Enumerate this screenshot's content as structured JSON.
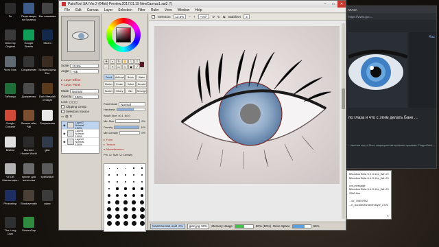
{
  "app": {
    "title": "PaintTool SAI Ver.2 (64bit) Preview.2017.01.19   NewCanvas1.sai2 (*)",
    "menu": [
      "File",
      "Edit",
      "Canvas",
      "Layer",
      "Selection",
      "Filter",
      "Ruler",
      "View",
      "Window",
      "Help"
    ]
  },
  "navigator": {
    "scale_label": "Scale",
    "scale_value": "12.5%",
    "angle_label": "Angle",
    "angle_value": "+0$"
  },
  "layer_panel": {
    "layer_effect": "Layer Effect",
    "layer_panel_label": "Layer Panel",
    "mode_label": "Mode",
    "mode_value": "Normal",
    "opacity_label": "Opacity",
    "opacity_value": "100%",
    "lock_label": "Lock",
    "clipping_group": "Clipping Group",
    "selection_source": "Selection Source",
    "layers": [
      {
        "name": "Layer2",
        "mode": "Normal",
        "opacity": "100%"
      },
      {
        "name": "Layer1",
        "mode": "Normal",
        "opacity": "100%"
      },
      {
        "name": "Layer3",
        "mode": "Normal",
        "opacity": "100%"
      }
    ]
  },
  "tool_panel": {
    "brushes": [
      "Pencil",
      "AirBrush",
      "Brush",
      "Water",
      "Marker",
      "Eraser",
      "Select",
      "Deselct",
      "Bucket",
      "Binary",
      "Blur",
      "Smudge"
    ],
    "paint_mode_label": "Paint Mode",
    "paint_mode_value": "Normal",
    "hardness_label": "Hardness",
    "brush_size_label": "Brush Size",
    "brush_size_mult": "x0.1",
    "brush_size_value": "80.0",
    "min_size_label": "Min Size",
    "min_size_value": "0%",
    "density_label": "Density",
    "density_value": "100",
    "min_density_label": "Min Density",
    "min_density_value": "0%",
    "form_label": "Form",
    "texture_label": "Texture",
    "misc_label": "Miscellaneous",
    "prs_label": "Prs",
    "size_label": "Size",
    "density_chk_label": "Density",
    "dot_sizes": [
      "0.6",
      "0.8",
      "1",
      "1.5",
      "2",
      "2.3",
      "2.6",
      "3",
      "3.5",
      "4",
      "5",
      "6",
      "7",
      "8",
      "9",
      "10",
      "12",
      "14",
      "16",
      "20",
      "25",
      "30",
      "35",
      "40",
      "50",
      "60",
      "70",
      "80",
      "100",
      "120",
      "160",
      "200",
      "250",
      "300",
      "350",
      "400",
      "450",
      "500",
      "600",
      "700",
      "800",
      "1000",
      "1200",
      "1600",
      "2000"
    ]
  },
  "canvas_toolbar": {
    "selection_label": "Selection",
    "zoom": "12.5%",
    "angle": "+0.0°",
    "stabilizer_label": "Stabilizer",
    "stabilizer_value": "3"
  },
  "statusbar": {
    "docs": [
      {
        "name": "NewCanvas1.sai2",
        "pct": "6%"
      },
      {
        "name": "glaz.jpg",
        "pct": "50%"
      }
    ],
    "memory_label": "Memory Usage",
    "memory_value": "50% (50%)",
    "memory_fill": 0.5,
    "drive_label": "Drive Space",
    "drive_value": "65%",
    "drive_fill": 0.65
  },
  "browser": {
    "tab": "ГЛАЗА",
    "address": "https://www.goo...",
    "headline": "по глаза и что с этим делать Банк ...",
    "caption": "...ажения могут быть защищены авторскими правами. Подробнее...",
    "side_link": "Kaz"
  },
  "popup": {
    "lines": [
      "Mleadow Beta 0-0-3-11a_Win.7z",
      "Mleadow Beta 0-0-3-11a_Win.7z",
      "...",
      "vcs-message",
      "Mleadow Beta 0-0-3-11a_Win.7z",
      "2560.fws",
      "...",
      "...ck_70657952",
      "...lr_Architectsmenth/style_27c0"
    ]
  },
  "desktop_icons": [
    {
      "label": "Fe",
      "color": "#2b2b2b"
    },
    {
      "label": "Dimmmy Original",
      "color": "#3a3a3a"
    },
    {
      "label": "Фото Mos",
      "color": "#606a72"
    },
    {
      "label": "Таблицы",
      "color": "#1f6e3a"
    },
    {
      "label": "Google Chrome",
      "color": "#d04a37"
    },
    {
      "label": "Вайтаг",
      "color": "#e0e0e0"
    },
    {
      "label": "ЧПОВ Магнитофон",
      "color": "#b4b4b4"
    },
    {
      "label": "Photoshop",
      "color": "#1e2e63"
    },
    {
      "label": "The Long Dark",
      "color": "#2e3033"
    },
    {
      "label": "Переговоры по бизнесу",
      "color": "#3d5a88"
    },
    {
      "label": "Google Sheets",
      "color": "#0f9d58"
    },
    {
      "label": "Сохранение",
      "color": "#343434"
    },
    {
      "label": "Документы",
      "color": "#4b4b4b"
    },
    {
      "label": "Season after Fall",
      "color": "#7a4e2e"
    },
    {
      "label": "Monster Hunter World",
      "color": "#2a2a2a"
    },
    {
      "label": "проект для агентства",
      "color": "#6b6b6b"
    },
    {
      "label": "Shadowmatic",
      "color": "#4a4035"
    },
    {
      "label": "ScreenCap",
      "color": "#2e8b3f"
    },
    {
      "label": "Без названия",
      "color": "#444"
    },
    {
      "label": "Steam",
      "color": "#13294b"
    },
    {
      "label": "Scrapini Alpha Exe",
      "color": "#3b2c22"
    },
    {
      "label": "Dark Messiah of Might",
      "color": "#5a3a1a"
    },
    {
      "label": "Сохранение",
      "color": "#e8e8e8"
    },
    {
      "label": "glaz",
      "color": "#2f3a4a"
    },
    {
      "label": "xpb0W8cb",
      "color": "#5a5a5a"
    },
    {
      "label": "офис",
      "color": "#3b3b3b"
    }
  ]
}
